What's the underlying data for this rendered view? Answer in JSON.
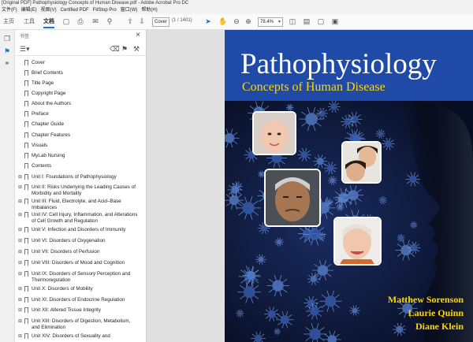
{
  "window": {
    "title": "[Original PDF] Pathophysiology Concepts of Human Disease.pdf - Adobe Acrobat Pro DC"
  },
  "menu": [
    "文件(F)",
    "编辑(E)",
    "视图(V)",
    "Certified PDF",
    "FitStop Pro",
    "窗口(W)",
    "帮助(H)"
  ],
  "tabs": {
    "home": "主页",
    "tools": "工具",
    "document": "文档"
  },
  "toolbar": {
    "page_value": "Cover",
    "page_count": "(1 / 1401)",
    "zoom": "78.4%"
  },
  "panel": {
    "title": "书签"
  },
  "bookmarks": [
    {
      "label": "Cover",
      "expandable": false
    },
    {
      "label": "Brief Contents",
      "expandable": false
    },
    {
      "label": "Title Page",
      "expandable": false
    },
    {
      "label": "Copyright Page",
      "expandable": false
    },
    {
      "label": "About the Authors",
      "expandable": false
    },
    {
      "label": "Preface",
      "expandable": false
    },
    {
      "label": "Chapter Guide",
      "expandable": false
    },
    {
      "label": "Chapter Features",
      "expandable": false
    },
    {
      "label": "Visuals",
      "expandable": false
    },
    {
      "label": "MyLab Nursing",
      "expandable": false
    },
    {
      "label": "Contents",
      "expandable": false
    },
    {
      "label": "Unit I: Foundations of Pathophysiology",
      "expandable": true
    },
    {
      "label": "Unit II: Risks Underlying the Leading Causes of Morbidity and Mortality",
      "expandable": true
    },
    {
      "label": "Unit III: Fluid, Electrolyte, and Acid–Base Imbalances",
      "expandable": true
    },
    {
      "label": "Unit IV: Cell Injury, Inflammation, and Alterations of Cell Growth and Regulation",
      "expandable": true
    },
    {
      "label": "Unit V: Infection and Disorders of Immunity",
      "expandable": true
    },
    {
      "label": "Unit VI: Disorders of Oxygenation",
      "expandable": true
    },
    {
      "label": "Unit VII: Disorders of Perfusion",
      "expandable": true
    },
    {
      "label": "Unit VIII: Disorders of Mood and Cognition",
      "expandable": true
    },
    {
      "label": "Unit IX: Disorders of Sensory Perception and Thermoregulation",
      "expandable": true
    },
    {
      "label": "Unit X: Disorders of Mobility",
      "expandable": true
    },
    {
      "label": "Unit XI: Disorders of Endocrine Regulation",
      "expandable": true
    },
    {
      "label": "Unit XII: Altered Tissue Integrity",
      "expandable": true
    },
    {
      "label": "Unit XIII: Disorders of Digestion, Metabolism, and Elimination",
      "expandable": true
    },
    {
      "label": "Unit XIV: Disorders of Sexuality and",
      "expandable": true
    }
  ],
  "cover": {
    "title": "Pathophysiology",
    "subtitle": "Concepts of Human Disease",
    "authors": [
      "Matthew Sorenson",
      "Laurie Quinn",
      "Diane Klein"
    ]
  },
  "colors": {
    "banner": "#1f4aa8",
    "title": "#ffffff",
    "subtitle": "#ffd700",
    "authors": "#ffd700",
    "accent": "#1473e6"
  }
}
